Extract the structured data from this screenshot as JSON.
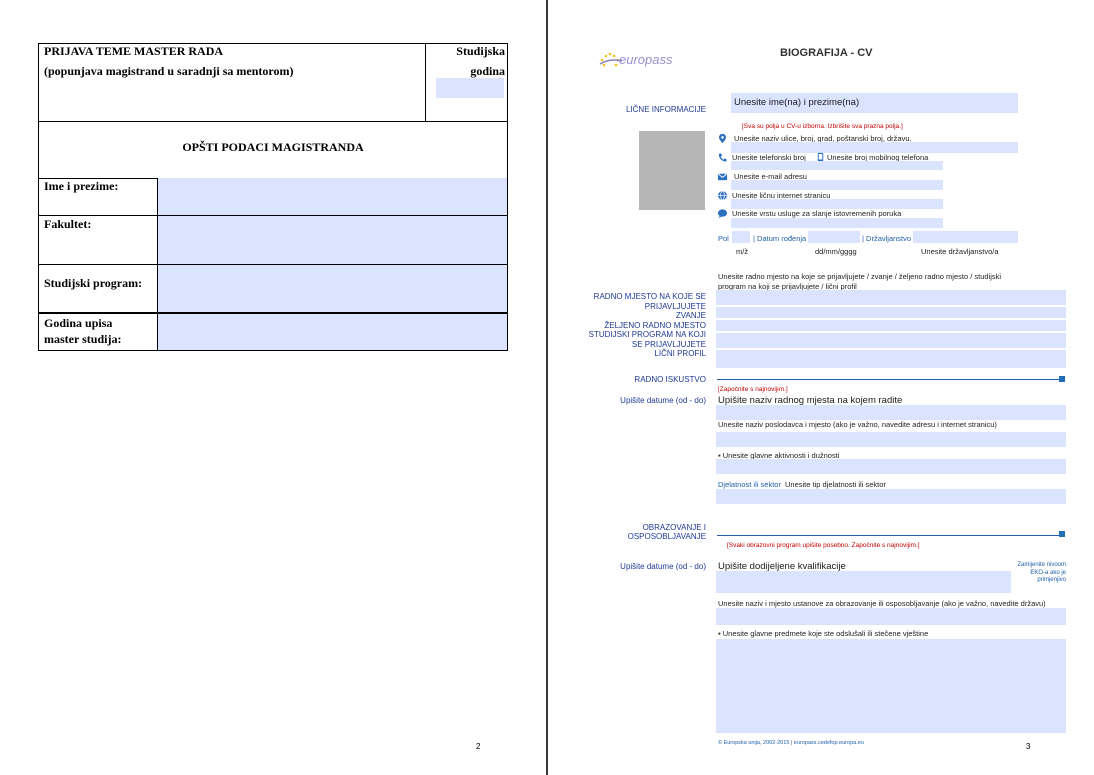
{
  "left_page": {
    "header": {
      "title": "PRIJAVA TEME MASTER RADA",
      "subtitle": "(popunjava magistrand u saradnji sa mentorom)",
      "year_label_1": "Studijska",
      "year_label_2": "godina"
    },
    "section_title": "OPŠTI  PODACI MAGISTRANDA",
    "rows": {
      "name": "Ime i prezime:",
      "faculty": "Fakultet:",
      "program": "Studijski program:",
      "year_line1": "Godina upisa",
      "year_line2": "master studija:"
    },
    "page_number": "2"
  },
  "right_page": {
    "logo_text": "europass",
    "title": "BIOGRAFIJA  - CV",
    "personal": {
      "section_label": "LIČNE  INFORMACIJE",
      "name_placeholder": "Unesite ime(na) i prezime(na)",
      "note": "[Sva su polja u CV-u izborna. Izbrišite sva prazna polja.]",
      "address": "Unesite naziv ulice, broj, grad, poštanski broj, državu.",
      "phone": "Unesite telefonski broj",
      "mobile": "Unesite broj mobilnog telefona",
      "email": "Unesite e-mail adresu",
      "web": "Unesite ličnu  internet stranicu",
      "im": "Unesite vrstu  usluge za slanje istovremenih poruka",
      "sex_label": "Pol",
      "birth_label": "| Datum rođenja",
      "nationality_label": "| Državljanstvo",
      "sex_value": "m/ž",
      "birth_value": "dd/mm/gggg",
      "nationality_value": "Unesite državljanstvo/a"
    },
    "job": {
      "label_lines": [
        "RADNO MJESTO NA  KOJE SE",
        "PRIJAVLJUJETE",
        "ZVANJE",
        "ŽELJENO RADNO MJESTO",
        "STUDIJSKI PROGRAM NA KOJI",
        "SE PRIJAVLJUJETE",
        "LIČNI PROFIL"
      ],
      "text_line1": "Unesite radno mjesto na koje se prijavljujete / zvanje /  željeno radno mjesto / studijski",
      "text_line2": "program na koji se prijavljujete / lični profil"
    },
    "experience": {
      "section_label": "RADNO ISKUSTVO",
      "note": "[Započnite s najnovijim.]",
      "dates_label": "Upišite datume (od - do)",
      "position": "Upišite naziv radnog mjesta na kojem radite",
      "employer": "Unesite naziv poslodavca i mjesto (ako je važno, navedite adresu i internet stranicu)",
      "activities": "▪ Unesite glavne aktivnosti i dužnosti",
      "sector_label": "Djelatnost ili sektor",
      "sector_text": "Unesite tip djelatnosti ili sektor"
    },
    "education": {
      "section_label_1": "OBRAZOVANJE I",
      "section_label_2": "OSPOSOBLJAVANJE",
      "note": "[Svaki obrazovni program upišite posebno. Započnite s najnovijim.]",
      "dates_label": "Upišite datume (od - do)",
      "qualification": "Upišite dodijeljene kvalifikacije",
      "eqf_1": "Zamijenite  nivoom",
      "eqf_2": "EKO-a ako je",
      "eqf_3": "primjenjivo",
      "institution": "Unesite naziv i mjesto ustanove za obrazovanje ili osposobljavanje (ako je važno, navedite državu)",
      "subjects": "▪ Unesite glavne predmete koje ste odslušali ili stečene vještine"
    },
    "footer": "© Europska unija, 2002-2015 | europass.cedefop.europa.eu",
    "page_number": "3"
  },
  "colors": {
    "field": "#dbe4ff",
    "label_blue": "#1f3a93",
    "note_red": "#c00000",
    "line_blue": "#1f5fa8"
  }
}
